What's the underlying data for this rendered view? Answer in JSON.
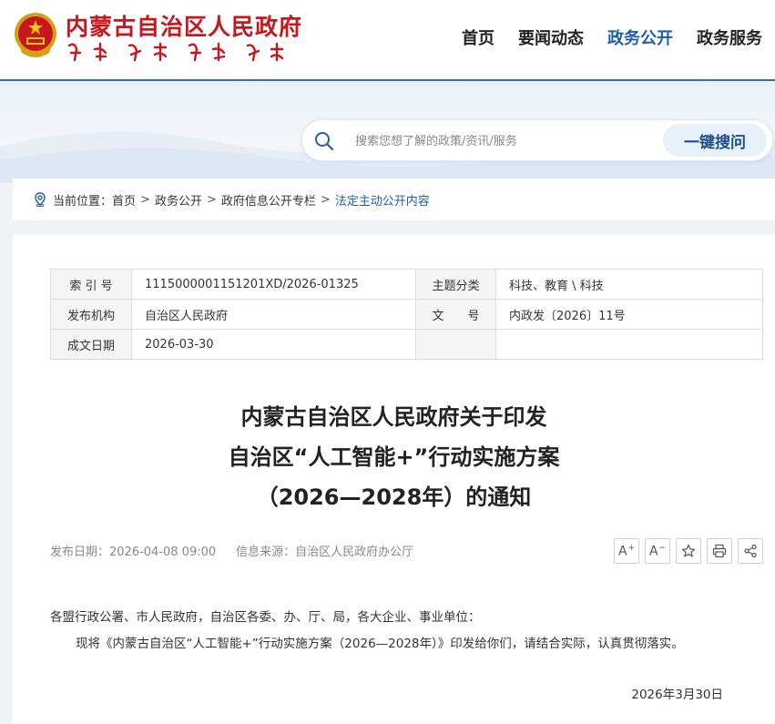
{
  "site": {
    "title": "内蒙古自治区人民政府",
    "accent": "#c8161d"
  },
  "nav": {
    "items": [
      {
        "label": "首页",
        "active": false
      },
      {
        "label": "要闻动态",
        "active": false
      },
      {
        "label": "政务公开",
        "active": true
      },
      {
        "label": "政务服务",
        "active": false
      }
    ],
    "active_color": "#1f5fa8"
  },
  "search": {
    "placeholder": "搜索您想了解的政策/资讯/服务",
    "button_label": "一键搜问",
    "icon": "search-icon"
  },
  "breadcrumb": {
    "prefix": "当前位置：",
    "items": [
      "首页",
      "政务公开",
      "政府信息公开专栏",
      "法定主动公开内容"
    ],
    "separator": ">",
    "icon": "location-icon"
  },
  "meta": {
    "rows": [
      {
        "label1": "索 引 号",
        "value1": "11150000011512​01XD/2026-01325",
        "label2": "主题分类",
        "value2": "科技、教育 \\ 科技"
      },
      {
        "label1": "发布机构",
        "value1": "自治区人民政府",
        "label2": "文　　号",
        "value2": "内政发〔2026〕11号"
      },
      {
        "label1": "成文日期",
        "value1": "2026-03-30",
        "label2": "",
        "value2": ""
      }
    ]
  },
  "document": {
    "title_lines": [
      "内蒙古自治区人民政府关于印发",
      "自治区“人工智能+”行动实施方案",
      "（2026—2028年）的通知"
    ],
    "publish_date": "发布日期：2026-04-08 09:00",
    "source": "信息来源：自治区人民政府办公厅",
    "salutation": "各盟行政公署、市人民政府，自治区各委、办、厅、局，各大企业、事业单位：",
    "body": "现将《内蒙古自治区“人工智能+”行动实施方案（2026—2028年）》印发给你们，请结合实际，认真贯彻落实。",
    "date": "2026年3月30日"
  },
  "tools": {
    "font_increase": "A",
    "font_decrease": "A",
    "plus_sign": "+",
    "minus_sign": "−",
    "icons": [
      "font-increase-icon",
      "font-decrease-icon",
      "star-icon",
      "print-icon",
      "share-icon"
    ]
  }
}
